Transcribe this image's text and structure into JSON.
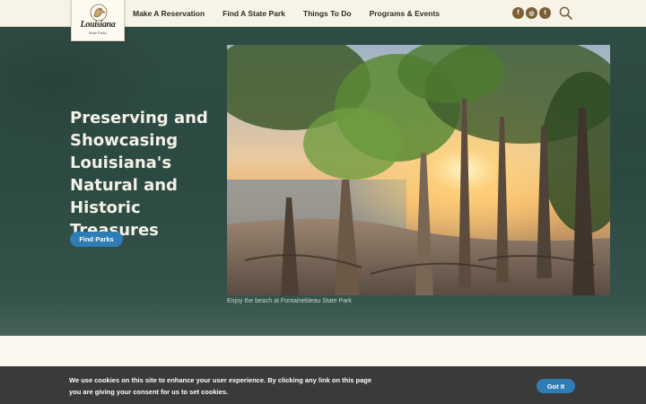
{
  "header": {
    "logo": {
      "text": "Louisiana",
      "subtext": "State Parks"
    },
    "nav": [
      {
        "label": "Make A Reservation"
      },
      {
        "label": "Find A State Park"
      },
      {
        "label": "Things To Do"
      },
      {
        "label": "Programs & Events"
      }
    ],
    "social": [
      {
        "icon": "facebook-icon",
        "glyph": "f"
      },
      {
        "icon": "instagram-icon",
        "glyph": "◎"
      },
      {
        "icon": "twitter-icon",
        "glyph": "t"
      }
    ],
    "search_icon": "search-icon"
  },
  "hero": {
    "title": "Preserving and Showcasing Louisiana's Natural and Historic Treasures",
    "button_label": "Find Parks",
    "photo_caption": "Enjoy the beach at Fontainebleau State Park"
  },
  "cookie_banner": {
    "text": "We use cookies on this site to enhance your user experience. By clicking any link on this page you are giving your consent for us to set cookies.",
    "button_label": "Got It"
  },
  "colors": {
    "accent_blue": "#2e7db4",
    "header_bg": "#f7f3e7",
    "hero_green": "#2f4c44",
    "social_brown": "#7b5f37",
    "cookie_bg": "#3a3a3a"
  }
}
